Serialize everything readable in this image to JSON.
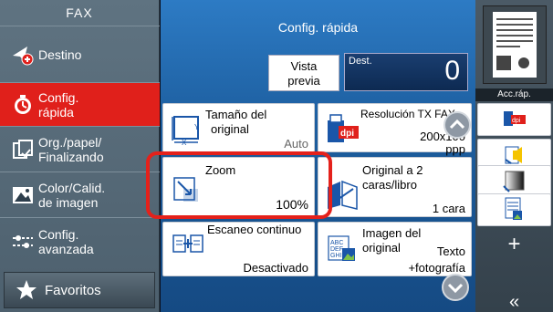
{
  "sidebar": {
    "title": "FAX",
    "items": [
      {
        "line1": "Destino",
        "line2": ""
      },
      {
        "line1": "Config.",
        "line2": "rápida"
      },
      {
        "line1": "Org./papel/",
        "line2": "Finalizando"
      },
      {
        "line1": "Color/Calid.",
        "line2": "de imagen"
      },
      {
        "line1": "Config.",
        "line2": "avanzada"
      }
    ],
    "favorites": "Favoritos"
  },
  "main": {
    "title": "Config. rápida",
    "preview_label_1": "Vista",
    "preview_label_2": "previa",
    "dest_label": "Dest.",
    "dest_count": "0",
    "cards": {
      "size": {
        "line1": "Tamaño del",
        "line2": "original",
        "value": "Auto"
      },
      "resolution": {
        "line1": "Resolución TX FAX",
        "value1": "200x100",
        "value2": "ppp",
        "icon_text": "dpi"
      },
      "zoom": {
        "line1": "Zoom",
        "value": "100%"
      },
      "duplex": {
        "line1": "Original a 2",
        "line2": "caras/libro",
        "value": "1 cara"
      },
      "continuous": {
        "line1": "Escaneo continuo",
        "value": "Desactivado"
      },
      "image": {
        "line1": "Imagen del",
        "line2": "original",
        "value1": "Texto",
        "value2": "+fotografía"
      }
    }
  },
  "right_panel": {
    "quick_access": "Acc.ráp.",
    "plus": "+",
    "back": "«",
    "btn1_icon_text": "dpi"
  },
  "colors": {
    "accent_red": "#e0201b",
    "main_blue": "#1d5e9f"
  }
}
